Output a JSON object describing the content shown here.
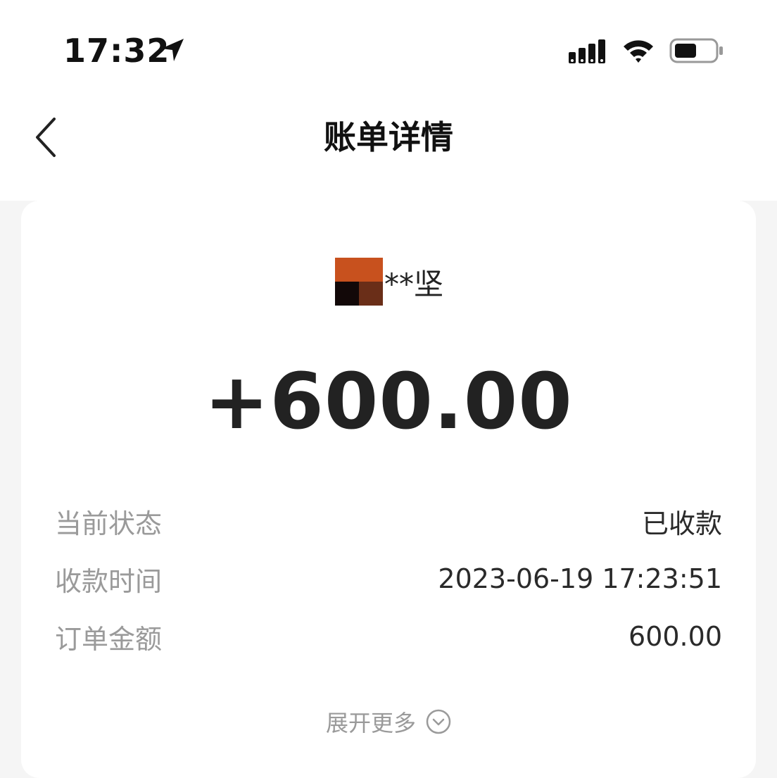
{
  "status_bar": {
    "time": "17:32",
    "icons": [
      "location-arrow-icon",
      "signal-icon",
      "wifi-icon",
      "battery-icon"
    ]
  },
  "nav": {
    "back_icon": "chevron-left-icon",
    "title": "账单详情"
  },
  "bill": {
    "payer_name": "**坚",
    "amount": "+600.00",
    "details": [
      {
        "label": "当前状态",
        "value": "已收款"
      },
      {
        "label": "收款时间",
        "value": "2023-06-19 17:23:51"
      },
      {
        "label": "订单金额",
        "value": "600.00"
      }
    ],
    "expand_label": "展开更多",
    "expand_icon": "chevron-down-circle-icon"
  },
  "colors": {
    "page_bg": "#f5f5f5",
    "card_bg": "#ffffff",
    "label_gray": "#9a9a9a",
    "text_dark": "#222222"
  }
}
